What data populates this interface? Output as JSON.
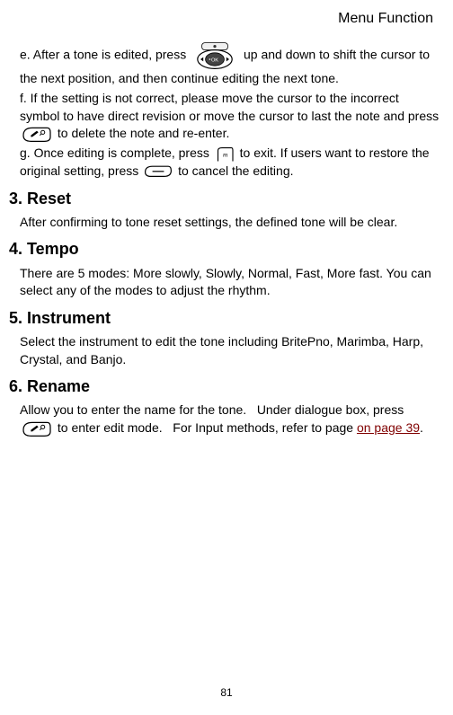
{
  "header": "Menu Function",
  "section_e": {
    "pre": "e. After a tone is edited, press ",
    "post": " up and down to shift the cursor to the next position, and then continue editing the next tone."
  },
  "section_f": {
    "pre": "f. If the setting is not correct, please move the cursor to the incorrect symbol to have direct revision or move the cursor to last the note and press ",
    "post": " to delete the note and re-enter."
  },
  "section_g": {
    "pre": "g. Once editing is complete, press ",
    "mid": " to exit. If users want to restore the original setting, press",
    "post": " to cancel the editing."
  },
  "reset": {
    "title": "3. Reset",
    "body": "After confirming to tone reset settings, the defined tone will be clear."
  },
  "tempo": {
    "title": "4. Tempo",
    "body": "There are 5 modes: More slowly, Slowly, Normal, Fast, More fast. You can select any of the modes to adjust the rhythm."
  },
  "instrument": {
    "title": "5. Instrument",
    "body": "Select the instrument to edit the tone including BritePno, Marimba, Harp, Crystal, and Banjo."
  },
  "rename": {
    "title": "6. Rename",
    "pre": "Allow you to enter the name for the tone.   Under dialogue box, press ",
    "mid": " to enter edit mode.   For Input methods, refer to page ",
    "link": "on page 39",
    "post": "."
  },
  "page_number": "81"
}
